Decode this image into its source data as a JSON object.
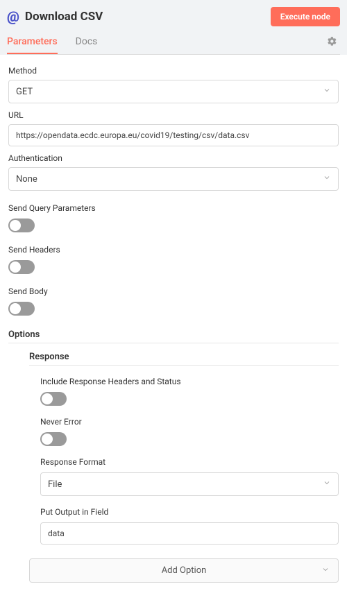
{
  "header": {
    "title": "Download CSV",
    "execute_button": "Execute node"
  },
  "tabs": {
    "parameters": "Parameters",
    "docs": "Docs"
  },
  "fields": {
    "method_label": "Method",
    "method_value": "GET",
    "url_label": "URL",
    "url_value": "https://opendata.ecdc.europa.eu/covid19/testing/csv/data.csv",
    "auth_label": "Authentication",
    "auth_value": "None",
    "send_query_label": "Send Query Parameters",
    "send_headers_label": "Send Headers",
    "send_body_label": "Send Body"
  },
  "options": {
    "label": "Options",
    "response_label": "Response",
    "include_headers_label": "Include Response Headers and Status",
    "never_error_label": "Never Error",
    "response_format_label": "Response Format",
    "response_format_value": "File",
    "put_output_label": "Put Output in Field",
    "put_output_value": "data",
    "add_option_label": "Add Option"
  }
}
